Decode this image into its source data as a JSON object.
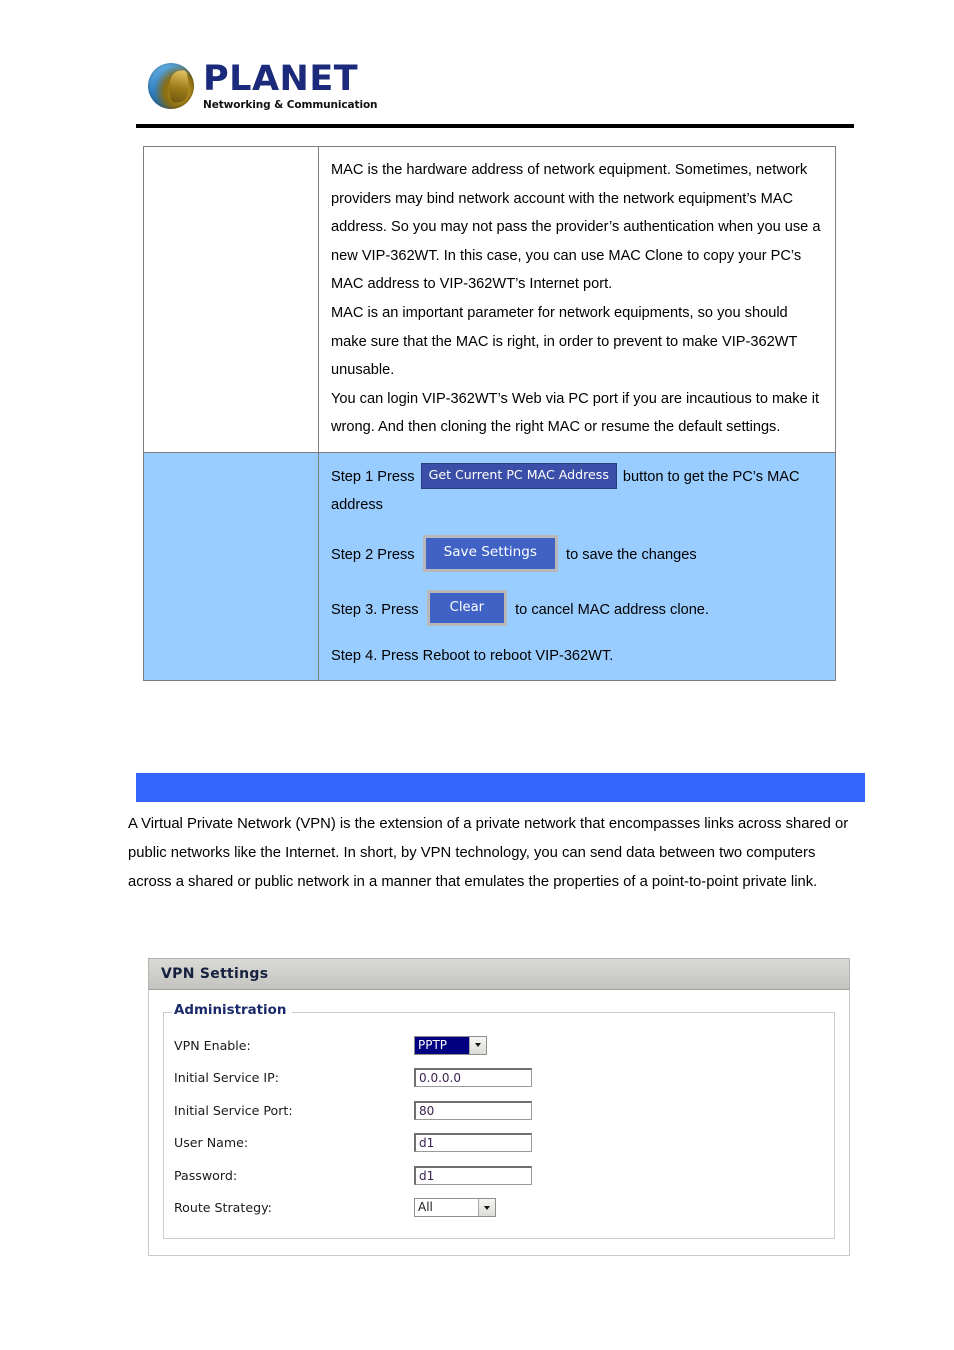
{
  "header": {
    "logo_word": "PLANET",
    "logo_tagline": "Networking & Communication"
  },
  "doc_table": {
    "description_paragraphs": [
      "MAC is the hardware address of network equipment. Sometimes, network providers may bind network account with the network equipment’s MAC address. So you may not pass the provider’s authentication when you use a new VIP-362WT. In this case, you can use MAC Clone to copy your PC’s MAC address to VIP-362WT’s Internet port.",
      "MAC is an important parameter for network equipments, so you should make sure that the MAC is right, in order to prevent to make VIP-362WT unusable.",
      "You can login VIP-362WT’s Web via PC port if you are incautious to make it wrong. And then cloning the right MAC or resume the default settings."
    ],
    "steps": {
      "step1_pre": "Step 1 Press",
      "step1_button": "Get Current PC MAC Address",
      "step1_post": "button to get the PC’s MAC address",
      "step2_pre": "Step 2 Press",
      "step2_button": "Save Settings",
      "step2_post": "to save the changes",
      "step3_pre": "Step 3. Press",
      "step3_button": "Clear",
      "step3_post": "to cancel MAC address clone.",
      "step4": "Step 4. Press Reboot to reboot VIP-362WT."
    }
  },
  "section_banner": {
    "label": "",
    "color": "#3366ff"
  },
  "intro": {
    "paragraph": "A Virtual Private Network (VPN) is the extension of a private network that encompasses links across shared or public networks like the Internet. In short, by VPN technology, you can send data between two computers across a shared or public network in a manner that emulates the properties of a point-to-point private link."
  },
  "vpn_panel": {
    "title": "VPN Settings",
    "fieldset_legend": "Administration",
    "fields": [
      {
        "label": "VPN Enable:",
        "type": "select",
        "value": "PPTP",
        "selected": true
      },
      {
        "label": "Initial Service IP:",
        "type": "text",
        "value": "0.0.0.0"
      },
      {
        "label": "Initial Service Port:",
        "type": "text",
        "value": "80"
      },
      {
        "label": "User Name:",
        "type": "text",
        "value": "d1"
      },
      {
        "label": "Password:",
        "type": "text",
        "value": "d1"
      },
      {
        "label": "Route Strategy:",
        "type": "select",
        "value": "All",
        "selected": false
      }
    ]
  }
}
